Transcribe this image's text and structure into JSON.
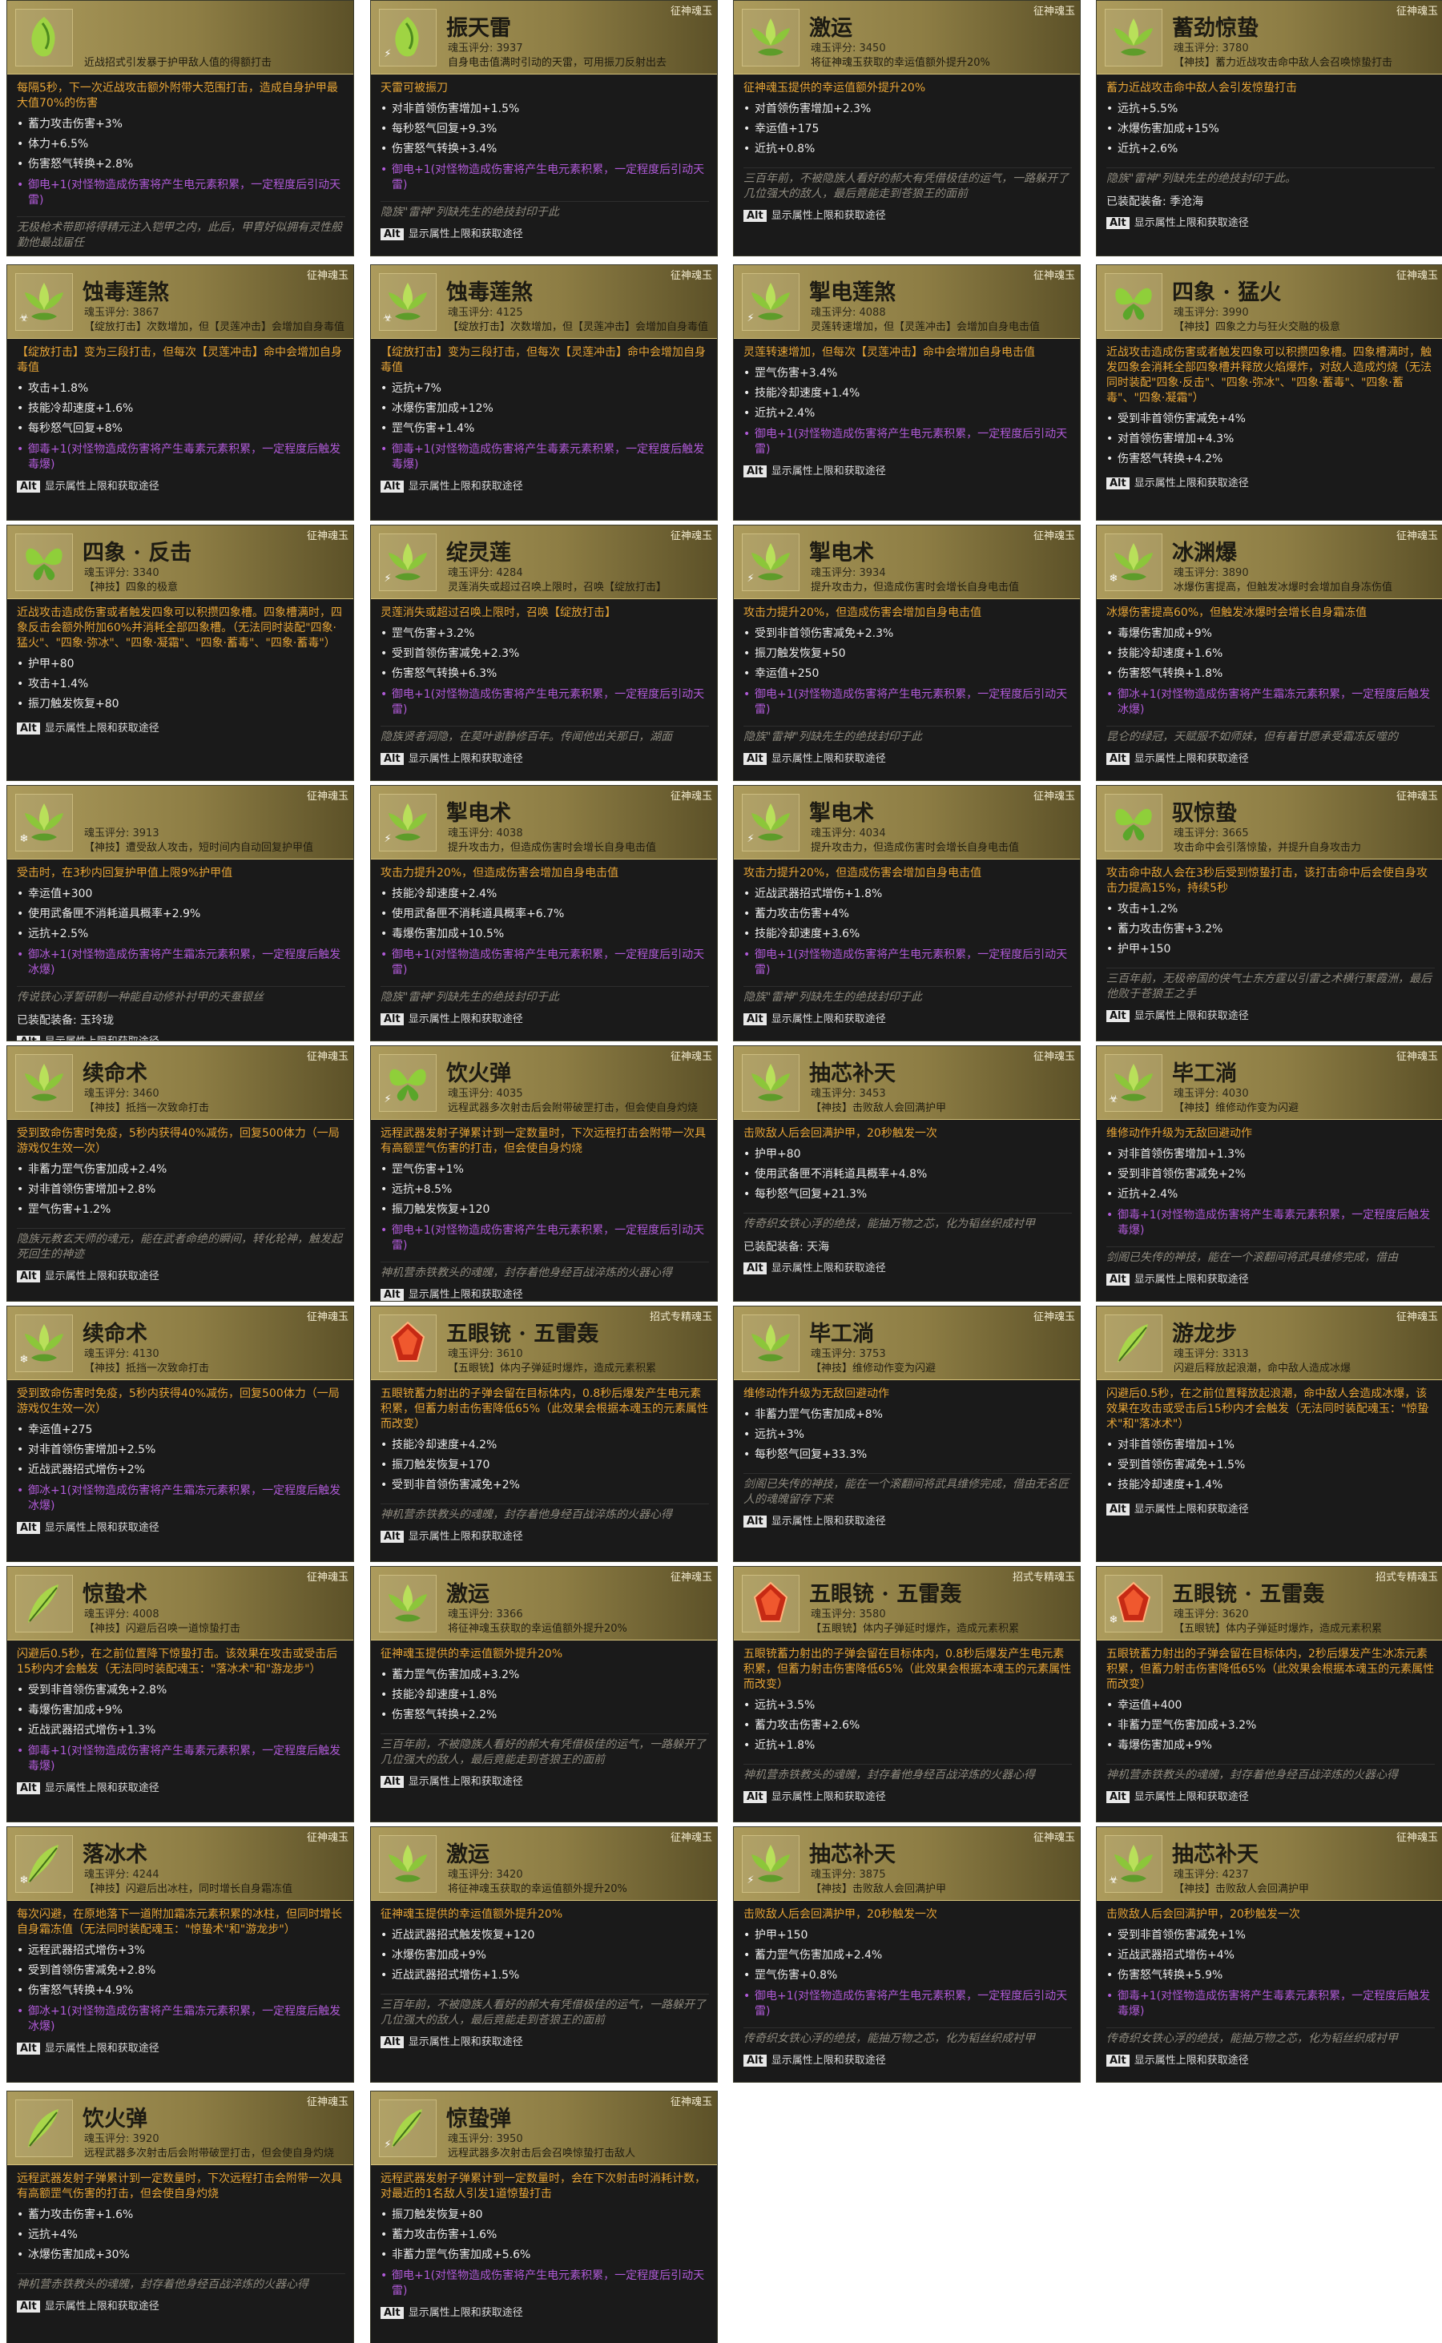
{
  "colors": {
    "header_gold": "#ac9b5c",
    "stat_orange": "#e6a436",
    "bonus_purple": "#b05ad8",
    "card_bg": "#1a1a1a"
  },
  "footer_key": "Alt",
  "footer_label": "显示属性上限和获取途径",
  "equipped_prefix": "已装配装备:",
  "cards": [
    {
      "name": "",
      "score": "",
      "desc": "近战招式引发暴于护甲敌人值的得额打击",
      "category": "",
      "element": "",
      "gem": "green",
      "effect": "每隔5秒，下一次近战攻击额外附带大范围打击，造成自身护甲最大值70%的伤害",
      "stats": [
        "蓄力攻击伤害+3%",
        "体力+6.5%",
        "伤害怒气转换+2.8%"
      ],
      "bonus": "御电+1(对怪物造成伤害将产生电元素积累，一定程度后引动天雷)",
      "flavor": "无极枪术带即将得精元注入铠甲之内，此后，甲胄好似拥有灵性般勤他最战届任",
      "equipped": "季沧海 玉玲珑"
    },
    {
      "name": "振天雷",
      "score": "魂玉评分: 3937",
      "desc": "自身电击值满时引动的天雷，可用振刀反射出去",
      "category": "征神魂玉",
      "element": "⚡",
      "gem": "green",
      "effect": "天雷可被振刀",
      "stats": [
        "对非首领伤害增加+1.5%",
        "每秒怒气回复+9.3%",
        "伤害怒气转换+3.4%"
      ],
      "bonus": "御电+1(对怪物造成伤害将产生电元素积累，一定程度后引动天雷)",
      "flavor": "隐族\"雷神\"列缺先生的绝技封印于此",
      "equipped": ""
    },
    {
      "name": "激运",
      "score": "魂玉评分: 3450",
      "desc": "将征神魂玉获取的幸运值额外提升20%",
      "category": "征神魂玉",
      "element": "",
      "gem": "lotus",
      "effect": "征神魂玉提供的幸运值额外提升20%",
      "stats": [
        "对首领伤害增加+2.3%",
        "幸运值+175",
        "近抗+0.8%"
      ],
      "bonus": "",
      "flavor": "三百年前，不被隐族人看好的郝大有凭借极佳的运气，一路躲开了几位强大的敌人，最后竟能走到苍狼王的面前",
      "equipped": ""
    },
    {
      "name": "蓄劲惊蛰",
      "score": "魂玉评分: 3780",
      "desc": "【神技】蓄力近战攻击命中敌人会召唤惊蛰打击",
      "category": "征神魂玉",
      "element": "",
      "gem": "lotus",
      "effect": "蓄力近战攻击命中敌人会引发惊蛰打击",
      "stats": [
        "远抗+5.5%",
        "冰爆伤害加成+15%",
        "近抗+2.6%"
      ],
      "bonus": "",
      "flavor": "隐族\"雷神\"列缺先生的绝技封印于此。",
      "equipped": "季沧海"
    },
    {
      "name": "蚀毒莲煞",
      "score": "魂玉评分: 3867",
      "desc": "【绽放打击】次数增加，但【灵莲冲击】会增加自身毒值",
      "category": "征神魂玉",
      "element": "☣",
      "gem": "lotus",
      "effect": "【绽放打击】变为三段打击，但每次【灵莲冲击】命中会增加自身毒值",
      "stats": [
        "攻击+1.8%",
        "技能冷却速度+1.6%",
        "每秒怒气回复+8%"
      ],
      "bonus": "御毒+1(对怪物造成伤害将产生毒素元素积累，一定程度后触发毒爆)",
      "flavor": "",
      "equipped": ""
    },
    {
      "name": "蚀毒莲煞",
      "score": "魂玉评分: 4125",
      "desc": "【绽放打击】次数增加，但【灵莲冲击】会增加自身毒值",
      "category": "征神魂玉",
      "element": "☣",
      "gem": "lotus",
      "effect": "【绽放打击】变为三段打击，但每次【灵莲冲击】命中会增加自身毒值",
      "stats": [
        "远抗+7%",
        "冰爆伤害加成+12%",
        "罡气伤害+1.4%"
      ],
      "bonus": "御毒+1(对怪物造成伤害将产生毒素元素积累，一定程度后触发毒爆)",
      "flavor": "",
      "equipped": ""
    },
    {
      "name": "掣电莲煞",
      "score": "魂玉评分: 4088",
      "desc": "灵莲转速增加，但【灵莲冲击】会增加自身电击值",
      "category": "征神魂玉",
      "element": "⚡",
      "gem": "lotus",
      "effect": "灵莲转速增加，但每次【灵莲冲击】命中会增加自身电击值",
      "stats": [
        "罡气伤害+3.4%",
        "技能冷却速度+1.4%",
        "近抗+2.4%"
      ],
      "bonus": "御电+1(对怪物造成伤害将产生电元素积累，一定程度后引动天雷)",
      "flavor": "",
      "equipped": ""
    },
    {
      "name": "四象 · 猛火",
      "score": "魂玉评分: 3990",
      "desc": "【神技】四象之力与狂火交融的极意",
      "category": "征神魂玉",
      "element": "",
      "gem": "butterfly",
      "effect": "近战攻击造成伤害或者触发四象可以积攒四象槽。四象槽满时，触发四象会消耗全部四象槽并释放火焰爆炸，对敌人造成灼烧（无法同时装配\"四象·反击\"、\"四象·弥冰\"、\"四象·蓄毒\"、\"四象·蓄毒\"、\"四象·凝霜\"）",
      "stats": [
        "受到非首领伤害减免+4%",
        "对首领伤害增加+4.3%",
        "伤害怒气转换+4.2%"
      ],
      "bonus": "",
      "flavor": "",
      "equipped": ""
    },
    {
      "name": "四象 · 反击",
      "score": "魂玉评分: 3340",
      "desc": "【神技】四象的极意",
      "category": "征神魂玉",
      "element": "",
      "gem": "butterfly",
      "effect": "近战攻击造成伤害或者触发四象可以积攒四象槽。四象槽满时，四象反击会额外附加60%并消耗全部四象槽。（无法同时装配\"四象·猛火\"、\"四象·弥冰\"、\"四象·凝霜\"、\"四象·蓄毒\"、\"四象·蓄毒\"）",
      "stats": [
        "护甲+80",
        "攻击+1.4%",
        "振刀触发恢复+80"
      ],
      "bonus": "",
      "flavor": "",
      "equipped": ""
    },
    {
      "name": "绽灵莲",
      "score": "魂玉评分: 4284",
      "desc": "灵莲消失或超过召唤上限时，召唤【绽放打击】",
      "category": "征神魂玉",
      "element": "⚡",
      "gem": "lotus",
      "effect": "灵莲消失或超过召唤上限时，召唤【绽放打击】",
      "stats": [
        "罡气伤害+3.2%",
        "受到首领伤害减免+2.3%",
        "伤害怒气转换+6.3%"
      ],
      "bonus": "御电+1(对怪物造成伤害将产生电元素积累，一定程度后引动天雷)",
      "flavor": "隐族贤者洞隐，在莫叶谢静修百年。传闻他出关那日，湖面",
      "equipped": ""
    },
    {
      "name": "掣电术",
      "score": "魂玉评分: 3934",
      "desc": "提升攻击力，但造成伤害时会增长自身电击值",
      "category": "征神魂玉",
      "element": "⚡",
      "gem": "lotus",
      "effect": "攻击力提升20%，但造成伤害会增加自身电击值",
      "stats": [
        "受到非首领伤害减免+2.3%",
        "振刀触发恢复+50",
        "幸运值+250"
      ],
      "bonus": "御电+1(对怪物造成伤害将产生电元素积累，一定程度后引动天雷)",
      "flavor": "隐族\"雷神\"列缺先生的绝技封印于此",
      "equipped": ""
    },
    {
      "name": "冰渊爆",
      "score": "魂玉评分: 3890",
      "desc": "冰爆伤害提高，但触发冰爆时会增加自身冻伤值",
      "category": "征神魂玉",
      "element": "❄",
      "gem": "lotus",
      "effect": "冰爆伤害提高60%，但触发冰爆时会增长自身霜冻值",
      "stats": [
        "毒爆伤害加成+9%",
        "技能冷却速度+1.6%",
        "伤害怒气转换+1.8%"
      ],
      "bonus": "御冰+1(对怪物造成伤害将产生霜冻元素积累，一定程度后触发冰爆)",
      "flavor": "昆仑的绿冠，天赋服不如师妹，但有着甘愿承受霜冻反噬的",
      "equipped": ""
    },
    {
      "name": "",
      "score": "魂玉评分: 3913",
      "desc": "【神技】遭受敌人攻击，短时间内自动回复护甲值",
      "category": "征神魂玉",
      "element": "❄",
      "gem": "lotus",
      "effect": "受击时，在3秒内回复护甲值上限9%护甲值",
      "stats": [
        "幸运值+300",
        "使用武备匣不消耗道具概率+2.9%",
        "远抗+2.5%"
      ],
      "bonus": "御冰+1(对怪物造成伤害将产生霜冻元素积累，一定程度后触发冰爆)",
      "flavor": "传说铁心浮誓研制一种能自动修补衬甲的天蚕银丝",
      "equipped": "玉玲珑"
    },
    {
      "name": "掣电术",
      "score": "魂玉评分: 4038",
      "desc": "提升攻击力，但造成伤害时会增长自身电击值",
      "category": "征神魂玉",
      "element": "⚡",
      "gem": "lotus",
      "effect": "攻击力提升20%，但造成伤害会增加自身电击值",
      "stats": [
        "技能冷却速度+2.4%",
        "使用武备匣不消耗道具概率+6.7%",
        "毒爆伤害加成+10.5%"
      ],
      "bonus": "御电+1(对怪物造成伤害将产生电元素积累，一定程度后引动天雷)",
      "flavor": "隐族\"雷神\"列缺先生的绝技封印于此",
      "equipped": ""
    },
    {
      "name": "掣电术",
      "score": "魂玉评分: 4034",
      "desc": "提升攻击力，但造成伤害时会增长自身电击值",
      "category": "征神魂玉",
      "element": "⚡",
      "gem": "lotus",
      "effect": "攻击力提升20%，但造成伤害会增加自身电击值",
      "stats": [
        "近战武器招式增伤+1.8%",
        "蓄力攻击伤害+4%",
        "技能冷却速度+3.6%"
      ],
      "bonus": "御电+1(对怪物造成伤害将产生电元素积累，一定程度后引动天雷)",
      "flavor": "隐族\"雷神\"列缺先生的绝技封印于此",
      "equipped": ""
    },
    {
      "name": "驭惊蛰",
      "score": "魂玉评分: 3665",
      "desc": "攻击命中会引落惊蛰，并提升自身攻击力",
      "category": "征神魂玉",
      "element": "",
      "gem": "butterfly",
      "effect": "攻击命中敌人会在3秒后受到惊蛰打击，该打击命中后会使自身攻击力提高15%，持续5秒",
      "stats": [
        "攻击+1.2%",
        "蓄力攻击伤害+3.2%",
        "护甲+150"
      ],
      "bonus": "",
      "flavor": "三百年前，无极帝国的侠气士东方霆以引雷之术横行聚霞洲，最后他败于苍狼王之手",
      "equipped": ""
    },
    {
      "name": "续命术",
      "score": "魂玉评分: 3460",
      "desc": "【神技】抵挡一次致命打击",
      "category": "征神魂玉",
      "element": "",
      "gem": "lotus",
      "effect": "受到致命伤害时免疫，5秒内获得40%减伤，回复500体力（一局游戏仅生效一次）",
      "stats": [
        "非蓄力罡气伤害加成+2.4%",
        "对非首领伤害增加+2.8%",
        "罡气伤害+1.2%"
      ],
      "bonus": "",
      "flavor": "隐族元教玄天师的魂元，能在武者命绝的瞬间，转化轮神，触发起死回生的神迹",
      "equipped": ""
    },
    {
      "name": "饮火弹",
      "score": "魂玉评分: 4035",
      "desc": "远程武器多次射击后会附带破罡打击，但会使自身灼烧",
      "category": "征神魂玉",
      "element": "⚡",
      "gem": "butterfly",
      "effect": "远程武器发射子弹累计到一定数量时，下次远程打击会附带一次具有高额罡气伤害的打击，但会使自身灼烧",
      "stats": [
        "罡气伤害+1%",
        "远抗+8.5%",
        "振刀触发恢复+120"
      ],
      "bonus": "御电+1(对怪物造成伤害将产生电元素积累，一定程度后引动天雷)",
      "flavor": "神机营赤铁教头的魂魄，封存着他身经百战淬炼的火器心得",
      "equipped": ""
    },
    {
      "name": "抽芯补天",
      "score": "魂玉评分: 3453",
      "desc": "【神技】击败敌人会回满护甲",
      "category": "征神魂玉",
      "element": "",
      "gem": "lotus",
      "effect": "击败敌人后会回满护甲，20秒触发一次",
      "stats": [
        "护甲+80",
        "使用武备匣不消耗道具概率+4.8%",
        "每秒怒气回复+21.3%"
      ],
      "bonus": "",
      "flavor": "传奇织女铁心浮的绝技，能抽万物之芯，化为韬丝织成衬甲",
      "equipped": "天海"
    },
    {
      "name": "毕工淌",
      "score": "魂玉评分: 4030",
      "desc": "【神技】维修动作变为闪避",
      "category": "征神魂玉",
      "element": "☣",
      "gem": "lotus",
      "effect": "维修动作升级为无敌回避动作",
      "stats": [
        "对非首领伤害增加+1.3%",
        "受到非首领伤害减免+2%",
        "近抗+2.4%"
      ],
      "bonus": "御毒+1(对怪物造成伤害将产生毒素元素积累，一定程度后触发毒爆)",
      "flavor": "剑阁已失传的神技，能在一个滚翻间将武具维修完成，借由",
      "equipped": ""
    },
    {
      "name": "续命术",
      "score": "魂玉评分: 4130",
      "desc": "【神技】抵挡一次致命打击",
      "category": "征神魂玉",
      "element": "❄",
      "gem": "lotus",
      "effect": "受到致命伤害时免疫，5秒内获得40%减伤，回复500体力（一局游戏仅生效一次）",
      "stats": [
        "幸运值+275",
        "对非首领伤害增加+2.5%",
        "近战武器招式增伤+2%"
      ],
      "bonus": "御冰+1(对怪物造成伤害将产生霜冻元素积累，一定程度后触发冰爆)",
      "flavor": "",
      "equipped": ""
    },
    {
      "name": "五眼铳 · 五雷轰",
      "score": "魂玉评分: 3610",
      "desc": "【五眼铳】体内子弹延时爆炸，造成元素积累",
      "category": "招式专精魂玉",
      "element": "",
      "gem": "red",
      "effect": "五眼铳蓄力射出的子弹会留在目标体内，0.8秒后爆发产生电元素积累，但蓄力射击伤害降低65%（此效果会根据本魂玉的元素属性而改变）",
      "stats": [
        "技能冷却速度+4.2%",
        "振刀触发恢复+170",
        "受到非首领伤害减免+2%"
      ],
      "bonus": "",
      "flavor": "神机营赤铁教头的魂魄，封存着他身经百战淬炼的火器心得",
      "equipped": ""
    },
    {
      "name": "毕工淌",
      "score": "魂玉评分: 3753",
      "desc": "【神技】维修动作变为闪避",
      "category": "征神魂玉",
      "element": "",
      "gem": "lotus",
      "effect": "维修动作升级为无敌回避动作",
      "stats": [
        "非蓄力罡气伤害加成+8%",
        "远抗+3%",
        "每秒怒气回复+33.3%"
      ],
      "bonus": "",
      "flavor": "剑阁已失传的神技，能在一个滚翻间将武具维修完成，借由无名匠人的魂魄留存下来",
      "equipped": ""
    },
    {
      "name": "游龙步",
      "score": "魂玉评分: 3313",
      "desc": "闪避后释放起浪潮，命中敌人造成冰爆",
      "category": "征神魂玉",
      "element": "",
      "gem": "feather",
      "effect": "闪避后0.5秒，在之前位置释放起浪潮，命中敌人会造成冰爆，该效果在攻击或受击后15秒内才会触发（无法同时装配魂玉：\"惊蛰术\"和\"落冰术\"）",
      "stats": [
        "对非首领伤害增加+1%",
        "受到首领伤害减免+1.5%",
        "技能冷却速度+1.4%"
      ],
      "bonus": "",
      "flavor": "",
      "equipped": ""
    },
    {
      "name": "惊蛰术",
      "score": "魂玉评分: 4008",
      "desc": "【神技】闪避后召唤一道惊蛰打击",
      "category": "征神魂玉",
      "element": "",
      "gem": "feather",
      "effect": "闪避后0.5秒，在之前位置降下惊蛰打击。该效果在攻击或受击后15秒内才会触发（无法同时装配魂玉：\"落冰术\"和\"游龙步\"）",
      "stats": [
        "受到非首领伤害减免+2.8%",
        "毒爆伤害加成+9%",
        "近战武器招式增伤+1.3%"
      ],
      "bonus": "御毒+1(对怪物造成伤害将产生毒素元素积累，一定程度后触发毒爆)",
      "flavor": "",
      "equipped": ""
    },
    {
      "name": "激运",
      "score": "魂玉评分: 3366",
      "desc": "将征神魂玉获取的幸运值额外提升20%",
      "category": "征神魂玉",
      "element": "",
      "gem": "lotus",
      "effect": "征神魂玉提供的幸运值额外提升20%",
      "stats": [
        "蓄力罡气伤害加成+3.2%",
        "技能冷却速度+1.8%",
        "伤害怒气转换+2.2%"
      ],
      "bonus": "",
      "flavor": "三百年前，不被隐族人看好的郝大有凭借极佳的运气，一路躲开了几位强大的敌人，最后竟能走到苍狼王的面前",
      "equipped": ""
    },
    {
      "name": "五眼铳 · 五雷轰",
      "score": "魂玉评分: 3580",
      "desc": "【五眼铳】体内子弹延时爆炸，造成元素积累",
      "category": "招式专精魂玉",
      "element": "",
      "gem": "red",
      "effect": "五眼铳蓄力射出的子弹会留在目标体内，0.8秒后爆发产生电元素积累，但蓄力射击伤害降低65%（此效果会根据本魂玉的元素属性而改变）",
      "stats": [
        "远抗+3.5%",
        "蓄力攻击伤害+2.6%",
        "近抗+1.8%"
      ],
      "bonus": "",
      "flavor": "神机营赤铁教头的魂魄，封存着他身经百战淬炼的火器心得",
      "equipped": ""
    },
    {
      "name": "五眼铳 · 五雷轰",
      "score": "魂玉评分: 3620",
      "desc": "【五眼铳】体内子弹延时爆炸，造成元素积累",
      "category": "招式专精魂玉",
      "element": "❄",
      "gem": "red",
      "effect": "五眼铳蓄力射出的子弹会留在目标体内，2秒后爆发产生冰冻元素积累，但蓄力射击伤害降低65%（此效果会根据本魂玉的元素属性而改变）",
      "stats": [
        "幸运值+400",
        "非蓄力罡气伤害加成+3.2%",
        "毒爆伤害加成+9%"
      ],
      "bonus": "",
      "flavor": "神机营赤铁教头的魂魄，封存着他身经百战淬炼的火器心得",
      "equipped": ""
    },
    {
      "name": "落冰术",
      "score": "魂玉评分: 4244",
      "desc": "【神技】闪避后出冰柱，同时增长自身霜冻值",
      "category": "征神魂玉",
      "element": "❄",
      "gem": "feather",
      "effect": "每次闪避，在原地落下一道附加霜冻元素积累的冰柱，但同时增长自身霜冻值（无法同时装配魂玉：\"惊蛰术\"和\"游龙步\"）",
      "stats": [
        "远程武器招式增伤+3%",
        "受到首领伤害减免+2.8%",
        "伤害怒气转换+4.9%"
      ],
      "bonus": "御冰+1(对怪物造成伤害将产生霜冻元素积累，一定程度后触发冰爆)",
      "flavor": "",
      "equipped": ""
    },
    {
      "name": "激运",
      "score": "魂玉评分: 3420",
      "desc": "将征神魂玉获取的幸运值额外提升20%",
      "category": "征神魂玉",
      "element": "",
      "gem": "lotus",
      "effect": "征神魂玉提供的幸运值额外提升20%",
      "stats": [
        "近战武器招式触发恢复+120",
        "冰爆伤害加成+9%",
        "近战武器招式增伤+1.5%"
      ],
      "bonus": "",
      "flavor": "三百年前，不被隐族人看好的郝大有凭借极佳的运气，一路躲开了几位强大的敌人，最后竟能走到苍狼王的面前",
      "equipped": ""
    },
    {
      "name": "抽芯补天",
      "score": "魂玉评分: 3875",
      "desc": "【神技】击败敌人会回满护甲",
      "category": "征神魂玉",
      "element": "⚡",
      "gem": "lotus",
      "effect": "击败敌人后会回满护甲，20秒触发一次",
      "stats": [
        "护甲+150",
        "蓄力罡气伤害加成+2.4%",
        "罡气伤害+0.8%"
      ],
      "bonus": "御电+1(对怪物造成伤害将产生电元素积累，一定程度后引动天雷)",
      "flavor": "传奇织女铁心浮的绝技，能抽万物之芯，化为韬丝织成衬甲",
      "equipped": ""
    },
    {
      "name": "抽芯补天",
      "score": "魂玉评分: 4237",
      "desc": "【神技】击败敌人会回满护甲",
      "category": "征神魂玉",
      "element": "☣",
      "gem": "lotus",
      "effect": "击败敌人后会回满护甲，20秒触发一次",
      "stats": [
        "受到非首领伤害减免+1%",
        "近战武器招式增伤+4%",
        "伤害怒气转换+5.9%"
      ],
      "bonus": "御毒+1(对怪物造成伤害将产生毒素元素积累，一定程度后触发毒爆)",
      "flavor": "传奇织女铁心浮的绝技，能抽万物之芯，化为韬丝织成衬甲",
      "equipped": ""
    },
    {
      "name": "饮火弹",
      "score": "魂玉评分: 3920",
      "desc": "远程武器多次射击后会附带破罡打击，但会使自身灼烧",
      "category": "征神魂玉",
      "element": "",
      "gem": "feather",
      "effect": "远程武器发射子弹累计到一定数量时，下次远程打击会附带一次具有高额罡气伤害的打击，但会使自身灼烧",
      "stats": [
        "蓄力攻击伤害+1.6%",
        "远抗+4%",
        "冰爆伤害加成+30%"
      ],
      "bonus": "",
      "flavor": "神机营赤铁教头的魂魄，封存着他身经百战淬炼的火器心得",
      "equipped": ""
    },
    {
      "name": "惊蛰弹",
      "score": "魂玉评分: 3950",
      "desc": "远程武器多次射击后会召唤惊蛰打击敌人",
      "category": "征神魂玉",
      "element": "⚡",
      "gem": "feather",
      "effect": "远程武器发射子弹累计到一定数量时，会在下次射击时消耗计数，对最近的1名敌人引发1道惊蛰打击",
      "stats": [
        "振刀触发恢复+80",
        "蓄力攻击伤害+1.6%",
        "非蓄力罡气伤害加成+5.6%"
      ],
      "bonus": "御电+1(对怪物造成伤害将产生电元素积累，一定程度后引动天雷)",
      "flavor": "",
      "equipped": ""
    }
  ]
}
